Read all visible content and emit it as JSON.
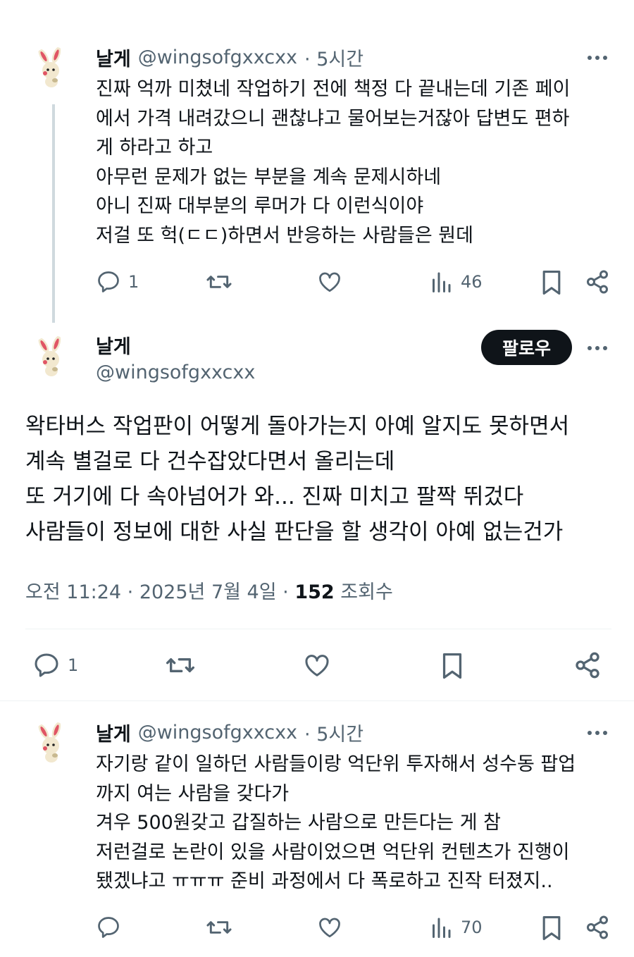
{
  "tweet1": {
    "name": "날게",
    "handle": "@wingsofgxxcxx",
    "time": "· 5시간",
    "text": "진짜 억까 미쳤네 작업하기 전에 책정 다 끝내는데 기존 페이\n에서 가격 내려갔으니 괜찮냐고 물어보는거잖아 답변도 편하\n게 하라고 하고\n아무런 문제가 없는 부분을 계속 문제시하네\n아니 진짜 대부분의 루머가 다 이런식이야\n저걸 또 헉(ㄷㄷ)하면서 반응하는 사람들은 뭔데",
    "replies": "1",
    "views": "46"
  },
  "main_tweet": {
    "name": "날게",
    "handle": "@wingsofgxxcxx",
    "follow_label": "팔로우",
    "text": "왁타버스 작업판이 어떻게 돌아가는지 아예 알지도 못하면서\n계속 별걸로 다 건수잡았다면서 올리는데\n또 거기에 다 속아넘어가 와... 진짜 미치고 팔짝 뛰겄다\n사람들이 정보에 대한 사실 판단을 할 생각이 아예 없는건가",
    "timestamp": "오전 11:24 · 2025년 7월 4일 · ",
    "view_count": "152",
    "view_label": "조회수",
    "replies": "1"
  },
  "tweet3": {
    "name": "날게",
    "handle": "@wingsofgxxcxx",
    "time": "· 5시간",
    "text": "자기랑 같이 일하던 사람들이랑 억단위 투자해서 성수동 팝업\n까지 여는 사람을 갖다가\n겨우 500원갖고 갑질하는 사람으로 만든다는 게 참\n저런걸로 논란이 있을 사람이었으면 억단위 컨텐츠가 진행이\n됐겠냐고 ㅠㅠㅠ 준비 과정에서 다 폭로하고 진작 터졌지..",
    "views": "70"
  },
  "colors": {
    "text": "#0f1419",
    "secondary": "#536471",
    "thread_line": "#cfd9de",
    "divider": "#eff3f4"
  },
  "icons": [
    "reply-icon",
    "retweet-icon",
    "like-icon",
    "views-icon",
    "bookmark-icon",
    "share-icon",
    "more-icon"
  ]
}
